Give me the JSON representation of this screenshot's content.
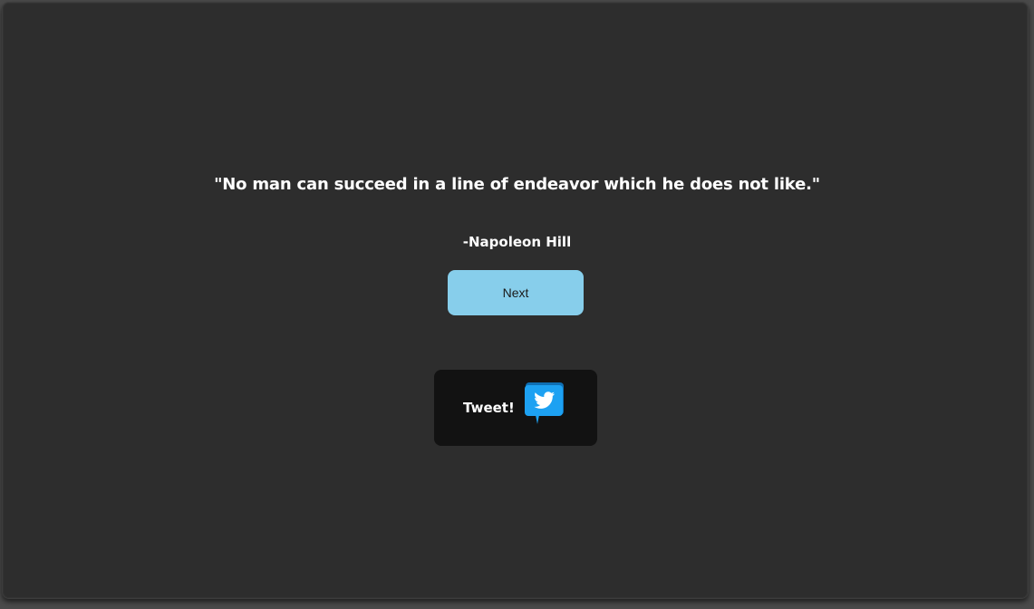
{
  "quote": {
    "text": "\"No man can succeed in a line of endeavor which he does not like.\"",
    "author": "-Napoleon Hill"
  },
  "buttons": {
    "next_label": "Next",
    "tweet_label": "Tweet!",
    "tweet_icon": "twitter-bird-speech-bubble-icon"
  },
  "colors": {
    "background": "#2d2d2d",
    "next_button": "#87ceeb",
    "tweet_button": "#121212",
    "twitter_blue": "#1da1f2"
  }
}
